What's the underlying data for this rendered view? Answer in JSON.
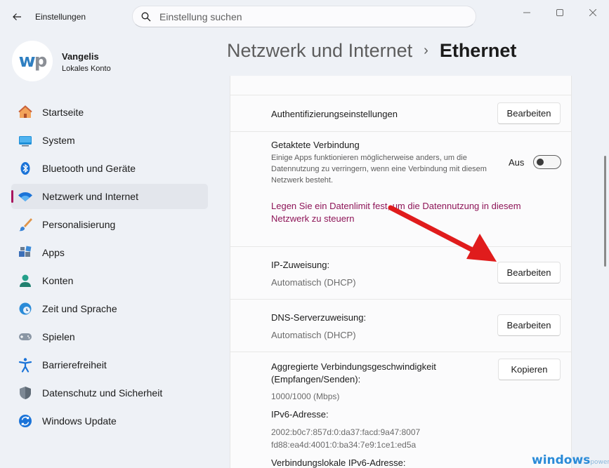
{
  "window": {
    "title": "Einstellungen",
    "controls": [
      "minimize-icon",
      "maximize-icon",
      "close-icon"
    ]
  },
  "search": {
    "placeholder": "Einstellung suchen",
    "value": ""
  },
  "profile": {
    "name": "Vangelis",
    "account": "Lokales Konto",
    "avatar_letters": "wp"
  },
  "sidebar": {
    "items": [
      {
        "label": "Startseite",
        "icon": "home-icon"
      },
      {
        "label": "System",
        "icon": "monitor-icon"
      },
      {
        "label": "Bluetooth und Geräte",
        "icon": "bluetooth-icon"
      },
      {
        "label": "Netzwerk und Internet",
        "icon": "wifi-icon",
        "active": true
      },
      {
        "label": "Personalisierung",
        "icon": "brush-icon"
      },
      {
        "label": "Apps",
        "icon": "apps-icon"
      },
      {
        "label": "Konten",
        "icon": "person-icon"
      },
      {
        "label": "Zeit und Sprache",
        "icon": "clock-globe-icon"
      },
      {
        "label": "Spielen",
        "icon": "gamepad-icon"
      },
      {
        "label": "Barrierefreiheit",
        "icon": "accessibility-icon"
      },
      {
        "label": "Datenschutz und Sicherheit",
        "icon": "shield-icon"
      },
      {
        "label": "Windows Update",
        "icon": "update-icon"
      }
    ]
  },
  "header": {
    "parent": "Netzwerk und Internet",
    "separator": "›",
    "current": "Ethernet"
  },
  "settings": {
    "auth": {
      "label": "Authentifizierungseinstellungen",
      "button": "Bearbeiten"
    },
    "metered": {
      "title": "Getaktete Verbindung",
      "description": "Einige Apps funktionieren möglicherweise anders, um die Datennutzung zu verringern, wenn eine Verbindung mit diesem Netzwerk besteht.",
      "toggle_label": "Aus",
      "toggle_on": false,
      "link": "Legen Sie ein Datenlimit fest, um die Datennutzung in diesem Netzwerk zu steuern"
    },
    "ip": {
      "label": "IP-Zuweisung:",
      "value": "Automatisch (DHCP)",
      "button": "Bearbeiten"
    },
    "dns": {
      "label": "DNS-Serverzuweisung:",
      "value": "Automatisch (DHCP)",
      "button": "Bearbeiten"
    },
    "properties": {
      "speed_label": "Aggregierte Verbindungsgeschwindigkeit (Empfangen/Senden):",
      "speed_value": "1000/1000 (Mbps)",
      "ipv6_label": "IPv6-Adresse:",
      "ipv6_values": [
        "2002:b0c7:857d:0:da37:facd:9a47:8007",
        "fd88:ea4d:4001:0:ba34:7e9:1ce1:ed5a"
      ],
      "linklocal_label": "Verbindungslokale IPv6-Adresse:",
      "copy_button": "Kopieren"
    }
  },
  "overlay": {
    "arrow_color": "#e01c1c"
  },
  "watermark": {
    "main": "windows",
    "suffix": "power"
  },
  "colors": {
    "accent": "#a8155e",
    "link": "#8e1558",
    "background": "#eef1f6"
  }
}
